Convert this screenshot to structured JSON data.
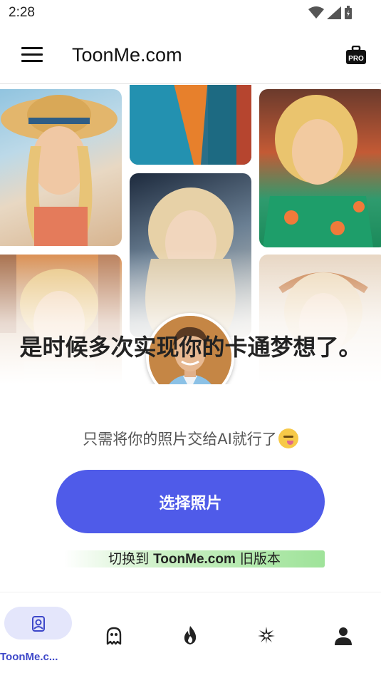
{
  "status_bar": {
    "time": "2:28"
  },
  "app_bar": {
    "title": "ToonMe.com",
    "pro_label": "PRO"
  },
  "hero": {
    "headline": "是时候多次实现你的卡通梦想了。",
    "subtitle": "只需将你的照片交给AI就行了"
  },
  "actions": {
    "primary_button": "选择照片",
    "switch_prefix": "切换到 ",
    "switch_brand": "ToonMe.com",
    "switch_suffix": " 旧版本"
  },
  "bottom_nav": {
    "items": [
      {
        "label": "ToonMe.c...",
        "icon": "portrait-icon",
        "active": true
      },
      {
        "label": "",
        "icon": "ghost-icon",
        "active": false
      },
      {
        "label": "",
        "icon": "fire-icon",
        "active": false
      },
      {
        "label": "",
        "icon": "sparkle-icon",
        "active": false
      },
      {
        "label": "",
        "icon": "profile-icon",
        "active": false
      }
    ]
  },
  "colors": {
    "accent": "#4f5be9",
    "nav_pill": "#e4e6fb",
    "nav_label": "#3d47c9",
    "switch_green": "#9fe39a"
  }
}
